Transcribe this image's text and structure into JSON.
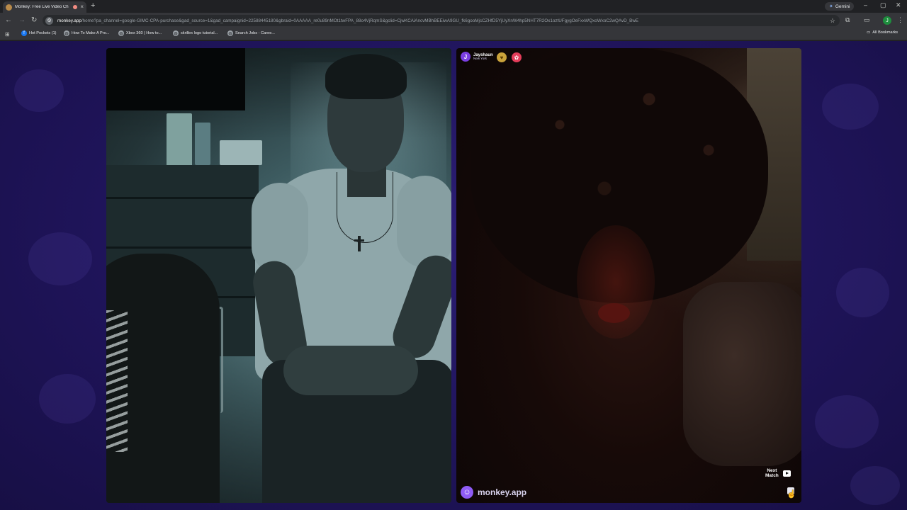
{
  "browser": {
    "tab": {
      "title": "Monkey: Free Live Video Ch",
      "close": "×"
    },
    "new_tab": "+",
    "gemini": "Gemini",
    "window_controls": [
      "–",
      "▢",
      "✕"
    ],
    "url_host": "monkey.app",
    "url_rest": "/home?pa_channel=google-GIMC-CPA-purchase&gad_source=1&gad_campaignid=22588445180&gbraid=0AAAAA_re0u89nMOt1twFPA_88o4VjRqmS&gclid=CjwKCAiAncvMBhBEEiwA9GU_fk6gooMjcCZHfD5YjUyXnW4hp5NHT7R2Ox1oztUFgygOeFxxWQxoWxoC2wQAvD_BwE",
    "bookmarks": [
      {
        "label": "Hot Pockets (1)",
        "icon": "facebook-icon"
      },
      {
        "label": "How To Make A Pro...",
        "icon": "globe-icon"
      },
      {
        "label": "Xbox 360 | How to...",
        "icon": "globe-icon"
      },
      {
        "label": "skrillex logo tutorial...",
        "icon": "globe-icon"
      },
      {
        "label": "Search Jobs - Caree...",
        "icon": "globe-icon"
      }
    ],
    "all_bookmarks": "All Bookmarks",
    "profile_initial": "J"
  },
  "match": {
    "avatar_initial": "J",
    "name": "Jayshaun",
    "location": "New York"
  },
  "brand": {
    "name": "monkey.app"
  },
  "controls": {
    "next_match_line1": "Next",
    "next_match_line2": "Match"
  },
  "colors": {
    "page_bg": "#1f145a",
    "accent": "#8f5cf6"
  }
}
